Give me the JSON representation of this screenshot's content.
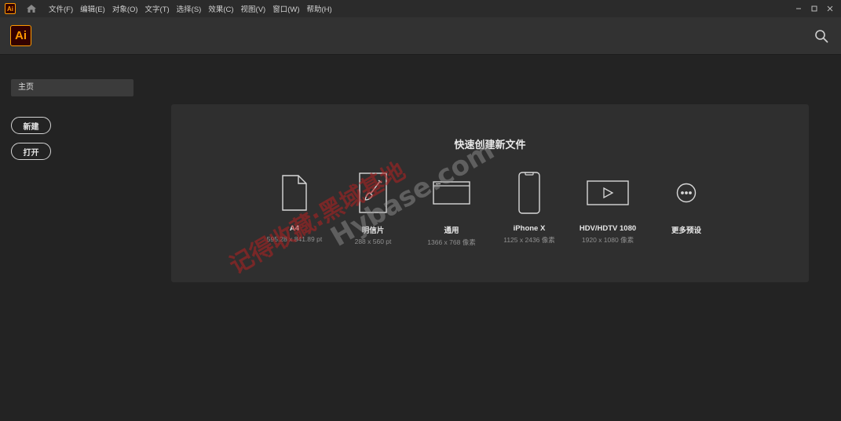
{
  "menubar": {
    "logo_text": "Ai",
    "items": [
      "文件(F)",
      "编辑(E)",
      "对象(O)",
      "文字(T)",
      "选择(S)",
      "效果(C)",
      "视图(V)",
      "窗口(W)",
      "帮助(H)"
    ],
    "icons": [
      "home-icon",
      "minimize-icon",
      "maximize-icon",
      "close-icon"
    ]
  },
  "appbar": {
    "logo_text": "Ai",
    "search_icon": "search-icon"
  },
  "sidebar": {
    "home_tab": "主页",
    "new_button": "新建",
    "open_button": "打开"
  },
  "quick_create": {
    "title": "快速创建新文件",
    "presets": [
      {
        "name": "A4",
        "dimensions": "595.28 x 841.89 pt",
        "icon": "document-icon"
      },
      {
        "name": "明信片",
        "dimensions": "288 x 560 pt",
        "icon": "postcard-brush-icon"
      },
      {
        "name": "通用",
        "dimensions": "1366 x 768 像素",
        "icon": "browser-window-icon"
      },
      {
        "name": "iPhone X",
        "dimensions": "1125 x 2436 像素",
        "icon": "phone-icon"
      },
      {
        "name": "HDV/HDTV 1080",
        "dimensions": "1920 x 1080 像素",
        "icon": "video-play-icon"
      },
      {
        "name": "更多预设",
        "dimensions": "",
        "icon": "more-icon"
      }
    ]
  },
  "watermark": {
    "line1": "记得收藏:黑域基地",
    "line2": "Hybase.com"
  },
  "colors": {
    "background": "#232323",
    "appbar": "#323232",
    "panel": "#2f2f2f",
    "brand_orange": "#ff9a00",
    "brand_dark": "#330000",
    "watermark": "#b52222"
  }
}
